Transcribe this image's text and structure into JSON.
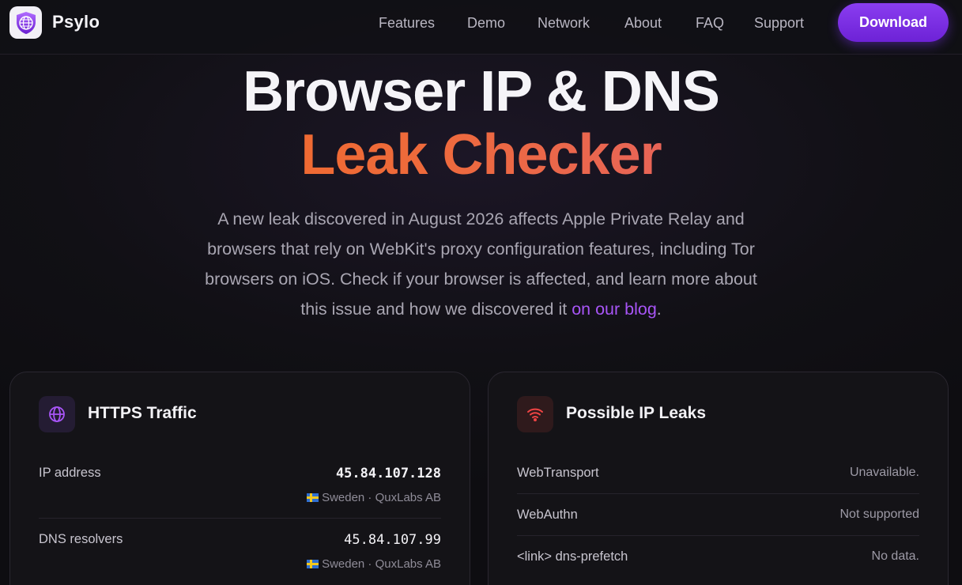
{
  "nav": {
    "brand": "Psylo",
    "links": [
      "Features",
      "Demo",
      "Network",
      "About",
      "FAQ",
      "Support"
    ],
    "download_label": "Download",
    "logo_icon": "shield-globe-icon"
  },
  "hero": {
    "title_line1": "Browser IP & DNS",
    "title_line2": "Leak Checker",
    "description": "A new leak discovered in August 2026 affects Apple Private Relay and browsers that rely on WebKit's proxy configuration features, including Tor browsers on iOS. Check if your browser is affected, and learn more about this issue and how we discovered it ",
    "link_text": "on our blog",
    "trailing": ".",
    "accent_color": "#a855f7"
  },
  "https_card": {
    "title": "HTTPS Traffic",
    "icon": "globe-icon",
    "rows": [
      {
        "label": "IP address",
        "value": "45.84.107.128",
        "sub": "Sweden · QuxLabs AB"
      },
      {
        "label": "DNS resolvers",
        "value": "45.84.107.99",
        "sub": "Sweden · QuxLabs AB"
      }
    ]
  },
  "leaks_card": {
    "title": "Possible IP Leaks",
    "icon": "wifi-icon",
    "rows": [
      {
        "label": "WebTransport",
        "value": "Unavailable."
      },
      {
        "label": "WebAuthn",
        "value": "Not supported"
      },
      {
        "label": "<link> dns-prefetch",
        "value": "No data."
      }
    ]
  }
}
